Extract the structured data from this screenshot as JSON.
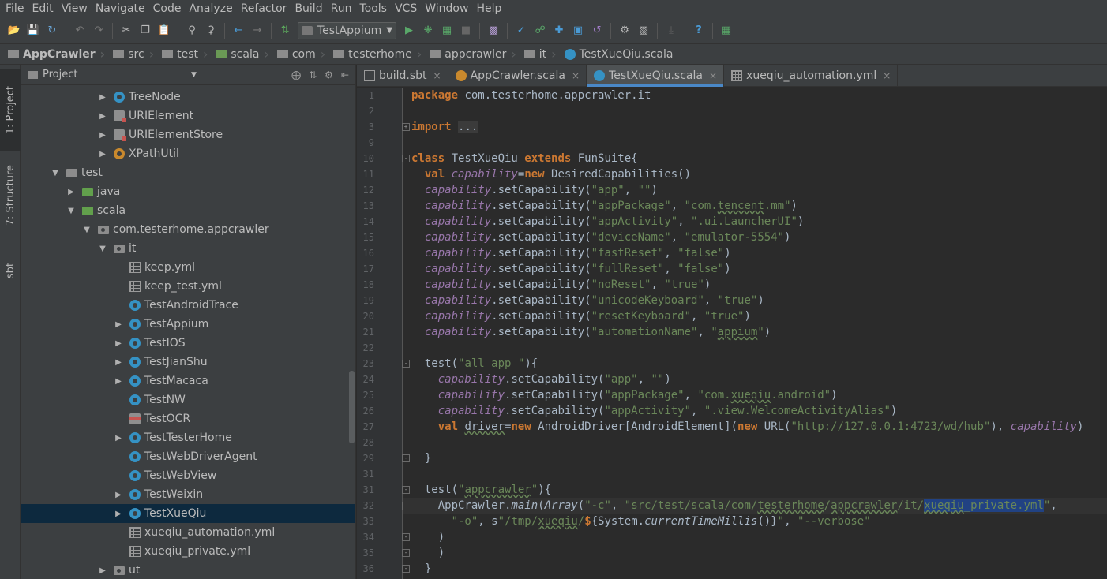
{
  "menu": [
    "File",
    "Edit",
    "View",
    "Navigate",
    "Code",
    "Analyze",
    "Refactor",
    "Build",
    "Run",
    "Tools",
    "VCS",
    "Window",
    "Help"
  ],
  "menu_mnemonics": [
    "F",
    "E",
    "V",
    "N",
    "C",
    "z",
    "R",
    "B",
    "u",
    "T",
    "S",
    "W",
    "H"
  ],
  "toolbar": {
    "run_config": "TestAppium"
  },
  "breadcrumb": [
    "AppCrawler",
    "src",
    "test",
    "scala",
    "com",
    "testerhome",
    "appcrawler",
    "it",
    "TestXueQiu.scala"
  ],
  "left_strip": [
    "1: Project",
    "7: Structure",
    "sbt"
  ],
  "project_panel": {
    "title": "Project",
    "tree": [
      {
        "label": "TreeNode",
        "icon": "scala",
        "depth": 5,
        "arrow": "right"
      },
      {
        "label": "URIElement",
        "icon": "object",
        "depth": 5,
        "arrow": "right"
      },
      {
        "label": "URIElementStore",
        "icon": "object",
        "depth": 5,
        "arrow": "right"
      },
      {
        "label": "XPathUtil",
        "icon": "trait",
        "depth": 5,
        "arrow": "right"
      },
      {
        "label": "test",
        "icon": "folder",
        "depth": 2,
        "arrow": "down"
      },
      {
        "label": "java",
        "icon": "folder-green",
        "depth": 3,
        "arrow": "right"
      },
      {
        "label": "scala",
        "icon": "folder-green",
        "depth": 3,
        "arrow": "down"
      },
      {
        "label": "com.testerhome.appcrawler",
        "icon": "pkg",
        "depth": 4,
        "arrow": "down"
      },
      {
        "label": "it",
        "icon": "pkg",
        "depth": 5,
        "arrow": "down"
      },
      {
        "label": "keep.yml",
        "icon": "yml",
        "depth": 6,
        "arrow": ""
      },
      {
        "label": "keep_test.yml",
        "icon": "yml",
        "depth": 6,
        "arrow": ""
      },
      {
        "label": "TestAndroidTrace",
        "icon": "scala",
        "depth": 6,
        "arrow": ""
      },
      {
        "label": "TestAppium",
        "icon": "scala",
        "depth": 6,
        "arrow": "right"
      },
      {
        "label": "TestIOS",
        "icon": "scala",
        "depth": 6,
        "arrow": "right"
      },
      {
        "label": "TestJianShu",
        "icon": "scala",
        "depth": 6,
        "arrow": "right"
      },
      {
        "label": "TestMacaca",
        "icon": "scala",
        "depth": 6,
        "arrow": "right"
      },
      {
        "label": "TestNW",
        "icon": "scala",
        "depth": 6,
        "arrow": ""
      },
      {
        "label": "TestOCR",
        "icon": "ocr",
        "depth": 6,
        "arrow": ""
      },
      {
        "label": "TestTesterHome",
        "icon": "scala",
        "depth": 6,
        "arrow": "right"
      },
      {
        "label": "TestWebDriverAgent",
        "icon": "scala",
        "depth": 6,
        "arrow": ""
      },
      {
        "label": "TestWebView",
        "icon": "scala",
        "depth": 6,
        "arrow": ""
      },
      {
        "label": "TestWeixin",
        "icon": "scala",
        "depth": 6,
        "arrow": "right"
      },
      {
        "label": "TestXueQiu",
        "icon": "scala",
        "depth": 6,
        "arrow": "right",
        "selected": true
      },
      {
        "label": "xueqiu_automation.yml",
        "icon": "yml",
        "depth": 6,
        "arrow": ""
      },
      {
        "label": "xueqiu_private.yml",
        "icon": "yml",
        "depth": 6,
        "arrow": ""
      },
      {
        "label": "ut",
        "icon": "pkg",
        "depth": 5,
        "arrow": "right"
      }
    ]
  },
  "tabs": [
    {
      "label": "build.sbt",
      "icon": "sbt",
      "active": false
    },
    {
      "label": "AppCrawler.scala",
      "icon": "trait",
      "active": false
    },
    {
      "label": "TestXueQiu.scala",
      "icon": "scala",
      "active": true
    },
    {
      "label": "xueqiu_automation.yml",
      "icon": "yml",
      "active": false
    }
  ],
  "editor": {
    "lines": [
      {
        "n": "1",
        "html": "<span class=\"kw\">package </span>com.testerhome.appcrawler.it"
      },
      {
        "n": "2",
        "html": ""
      },
      {
        "n": "3",
        "html": "<span class=\"kw\">import </span><span class=\"fold-box\">...</span>",
        "fold": "plus"
      },
      {
        "n": "9",
        "html": ""
      },
      {
        "n": "10",
        "html": "<span class=\"kw\">class </span>TestXueQiu <span class=\"kw\">extends </span>FunSuite{",
        "fold": "minus"
      },
      {
        "n": "11",
        "html": "  <span class=\"kw\">val </span><span class=\"it\">capability</span>=<span class=\"kw\">new </span>DesiredCapabilities()"
      },
      {
        "n": "12",
        "html": "  <span class=\"it\">capability</span>.setCapability(<span class=\"str\">\"app\"</span>, <span class=\"str\">\"\"</span>)"
      },
      {
        "n": "13",
        "html": "  <span class=\"it\">capability</span>.setCapability(<span class=\"str\">\"appPackage\"</span>, <span class=\"str\">\"com.<span class=\"ul\">tencent</span>.mm\"</span>)"
      },
      {
        "n": "14",
        "html": "  <span class=\"it\">capability</span>.setCapability(<span class=\"str\">\"appActivity\"</span>, <span class=\"str\">\".ui.LauncherUI\"</span>)"
      },
      {
        "n": "15",
        "html": "  <span class=\"it\">capability</span>.setCapability(<span class=\"str\">\"deviceName\"</span>, <span class=\"str\">\"emulator-5554\"</span>)"
      },
      {
        "n": "16",
        "html": "  <span class=\"it\">capability</span>.setCapability(<span class=\"str\">\"fastReset\"</span>, <span class=\"str\">\"false\"</span>)"
      },
      {
        "n": "17",
        "html": "  <span class=\"it\">capability</span>.setCapability(<span class=\"str\">\"fullReset\"</span>, <span class=\"str\">\"false\"</span>)"
      },
      {
        "n": "18",
        "html": "  <span class=\"it\">capability</span>.setCapability(<span class=\"str\">\"noReset\"</span>, <span class=\"str\">\"true\"</span>)"
      },
      {
        "n": "19",
        "html": "  <span class=\"it\">capability</span>.setCapability(<span class=\"str\">\"unicodeKeyboard\"</span>, <span class=\"str\">\"true\"</span>)"
      },
      {
        "n": "20",
        "html": "  <span class=\"it\">capability</span>.setCapability(<span class=\"str\">\"resetKeyboard\"</span>, <span class=\"str\">\"true\"</span>)"
      },
      {
        "n": "21",
        "html": "  <span class=\"it\">capability</span>.setCapability(<span class=\"str\">\"automationName\"</span>, <span class=\"str\">\"<span class=\"ul\">appium</span>\"</span>)"
      },
      {
        "n": "22",
        "html": ""
      },
      {
        "n": "23",
        "html": "  test(<span class=\"str\">\"all app \"</span>){",
        "fold": "minus"
      },
      {
        "n": "24",
        "html": "    <span class=\"it\">capability</span>.setCapability(<span class=\"str\">\"app\"</span>, <span class=\"str\">\"\"</span>)"
      },
      {
        "n": "25",
        "html": "    <span class=\"it\">capability</span>.setCapability(<span class=\"str\">\"appPackage\"</span>, <span class=\"str\">\"com.<span class=\"ul\">xueqiu</span>.android\"</span>)"
      },
      {
        "n": "26",
        "html": "    <span class=\"it\">capability</span>.setCapability(<span class=\"str\">\"appActivity\"</span>, <span class=\"str\">\".view.WelcomeActivityAlias\"</span>)"
      },
      {
        "n": "27",
        "html": "    <span class=\"kw\">val </span><span class=\"ul\">driver</span>=<span class=\"kw\">new </span>AndroidDriver[AndroidElement](<span class=\"kw\">new </span>URL(<span class=\"str\">\"http://127.0.0.1:4723/wd/hub\"</span>), <span class=\"it\">capability</span>)"
      },
      {
        "n": "28",
        "html": ""
      },
      {
        "n": "29",
        "html": "  }",
        "fold": "minus"
      },
      {
        "n": "31",
        "html": ""
      },
      {
        "n": "31",
        "html": "  test(<span class=\"str\">\"<span class=\"ul\">appcrawler</span>\"</span>){",
        "fold": "minus"
      },
      {
        "n": "32",
        "html": "    AppCrawler.<span class=\"fn\">main</span>(<span class=\"fn\">Array</span>(<span class=\"str\">\"-c\"</span>, <span class=\"str\">\"src/test/scala/com/<span class=\"ul\">testerhome</span>/<span class=\"ul\">appcrawler</span>/it/<span class=\"sel\"><span class=\"ul\">xueqiu</span>_private.yml</span>\"</span>,",
        "fold": "minus",
        "caret": true,
        "bulb": true
      },
      {
        "n": "33",
        "html": "      <span class=\"str\">\"-o\"</span>, s<span class=\"str\">\"/tmp/<span class=\"ul\">xueqiu</span>/</span><span class=\"kw\">$</span>{System.<span class=\"fn\">currentTimeMillis</span>()}<span class=\"str\">\"</span>, <span class=\"str\">\"--verbose\"</span>"
      },
      {
        "n": "34",
        "html": "    )",
        "fold": "minus"
      },
      {
        "n": "35",
        "html": "    )",
        "fold": "minus"
      },
      {
        "n": "36",
        "html": "  }",
        "fold": "minus"
      }
    ]
  }
}
